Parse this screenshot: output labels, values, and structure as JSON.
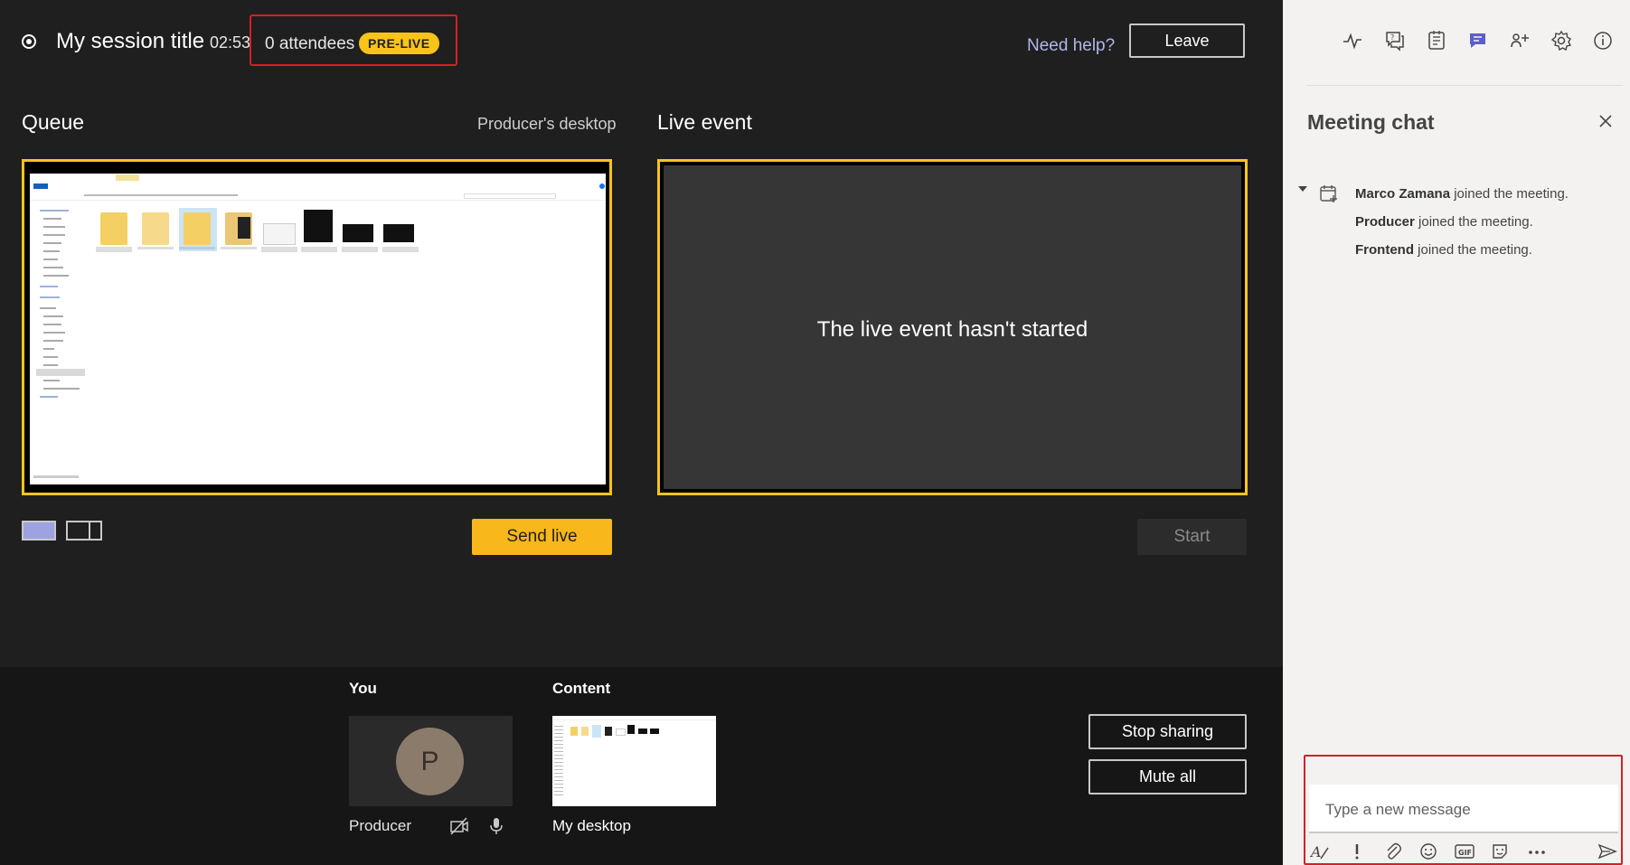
{
  "header": {
    "session_title": "My session title",
    "timer": "02:53",
    "attendees": "0 attendees",
    "badge": "PRE-LIVE",
    "need_help": "Need help?",
    "leave": "Leave"
  },
  "queue": {
    "title": "Queue",
    "source_label": "Producer's desktop",
    "send_live": "Send live"
  },
  "live_event": {
    "title": "Live event",
    "message": "The live event hasn't started",
    "start": "Start"
  },
  "tray": {
    "you_label": "You",
    "content_label": "Content",
    "avatar_initial": "P",
    "producer_name": "Producer",
    "content_name": "My desktop",
    "stop_sharing": "Stop sharing",
    "mute_all": "Mute all"
  },
  "panel": {
    "toolbar_icons": [
      "health-icon",
      "qna-icon",
      "notes-icon",
      "chat-icon",
      "participants-icon",
      "settings-icon",
      "info-icon"
    ],
    "chat_title": "Meeting chat",
    "messages": [
      {
        "name": "Marco Zamana",
        "text": " joined the meeting."
      },
      {
        "name": "Producer",
        "text": " joined the meeting."
      },
      {
        "name": "Frontend",
        "text": " joined the meeting."
      }
    ],
    "composer_placeholder": "Type a new message",
    "composer_tools": [
      "format-icon",
      "important-icon",
      "attach-icon",
      "emoji-icon",
      "gif-icon",
      "sticker-icon",
      "more-icon"
    ],
    "send_icon": "send-icon"
  },
  "colors": {
    "accent_yellow": "#f8c41a",
    "highlight_red": "#d51f26",
    "chat_active": "#5b5fc7",
    "link_purple": "#b4b6e8"
  }
}
